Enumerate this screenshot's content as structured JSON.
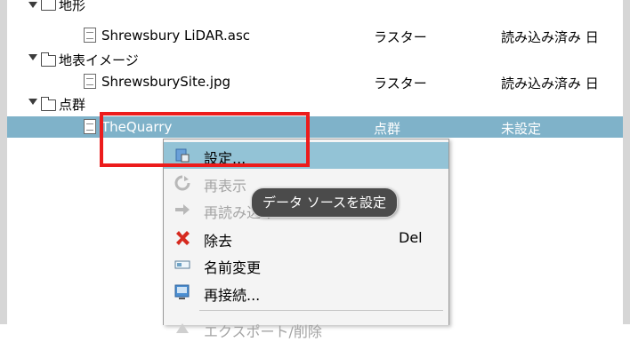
{
  "tree": {
    "rows": [
      {
        "name": "地形"
      },
      {
        "name": "Shrewsbury LiDAR.asc",
        "type": "ラスター",
        "status": "読み込み済み 日"
      },
      {
        "name": "地表イメージ"
      },
      {
        "name": "ShrewsburySite.jpg",
        "type": "ラスター",
        "status": "読み込み済み 日"
      },
      {
        "name": "点群"
      },
      {
        "name": "TheQuarry",
        "type": "点群",
        "status": "未設定"
      }
    ]
  },
  "context_menu": {
    "items": [
      {
        "label": "設定...",
        "shortcut": "",
        "icon": "settings-icon"
      },
      {
        "label": "再表示",
        "shortcut": "",
        "icon": "refresh-icon"
      },
      {
        "label": "再読み込み",
        "shortcut": "",
        "icon": "reload-arrow-icon"
      },
      {
        "label": "除去",
        "shortcut": "Del",
        "icon": "remove-x-icon"
      },
      {
        "label": "名前変更",
        "shortcut": "",
        "icon": "rename-icon"
      },
      {
        "label": "再接続...",
        "shortcut": "",
        "icon": "reconnect-icon"
      },
      {
        "label": "エクスポート/削除",
        "shortcut": "",
        "icon": "export-icon"
      }
    ]
  },
  "tooltip": {
    "text": "データ ソースを設定"
  },
  "colors": {
    "selection": "#7fb2c9",
    "menu_highlight": "#93c3d6",
    "annotation": "#ec1c1c",
    "remove_icon": "#d62a1f"
  }
}
